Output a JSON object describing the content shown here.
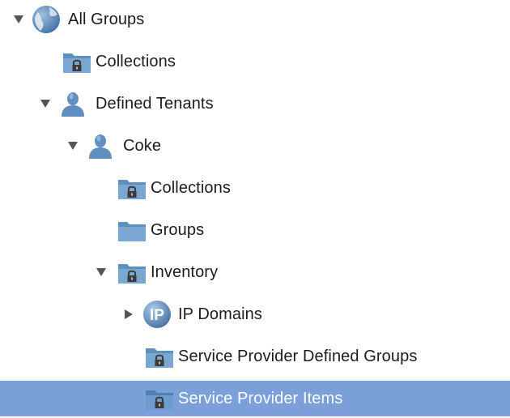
{
  "tree": {
    "items": [
      {
        "label": "All Groups",
        "icon": "globe-icon",
        "toggle": "expanded"
      },
      {
        "label": "Collections",
        "icon": "locked-folder-icon",
        "toggle": "none"
      },
      {
        "label": "Defined Tenants",
        "icon": "person-icon",
        "toggle": "expanded"
      },
      {
        "label": "Coke",
        "icon": "person-icon",
        "toggle": "expanded"
      },
      {
        "label": "Collections",
        "icon": "locked-folder-icon",
        "toggle": "none"
      },
      {
        "label": "Groups",
        "icon": "folder-icon",
        "toggle": "none"
      },
      {
        "label": "Inventory",
        "icon": "locked-folder-icon",
        "toggle": "expanded"
      },
      {
        "label": "IP Domains",
        "icon": "ip-icon",
        "toggle": "collapsed"
      },
      {
        "label": "Service Provider Defined Groups",
        "icon": "locked-folder-icon",
        "toggle": "none"
      },
      {
        "label": "Service Provider Items",
        "icon": "locked-folder-icon",
        "toggle": "none",
        "selected": true
      }
    ],
    "ip_icon_text": "IP",
    "colors": {
      "selection": "#7b9fd8",
      "icon_blue": "#5f8fbf",
      "toggle": "#555555"
    }
  }
}
